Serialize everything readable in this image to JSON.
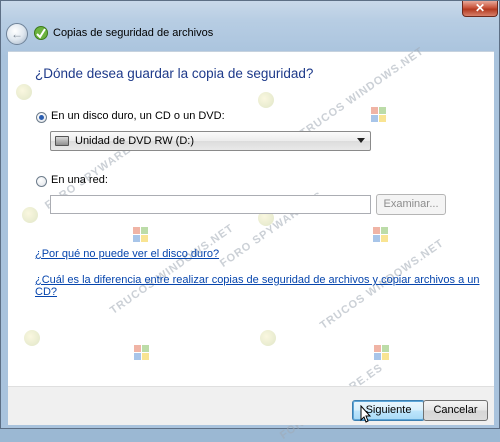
{
  "window": {
    "title": "Copias de seguridad de archivos",
    "close_glyph": "✕",
    "back_glyph": "←",
    "icons": [
      "back-arrow-icon",
      "backup-app-icon",
      "close-icon"
    ]
  },
  "heading": "¿Dónde desea guardar la copia de seguridad?",
  "option_disk": {
    "label": "En un disco duro, un CD o un DVD:",
    "selected": true,
    "drive_value": "Unidad de DVD RW (D:)"
  },
  "option_network": {
    "label": "En una red:",
    "selected": false,
    "path_value": "",
    "browse_label": "Examinar..."
  },
  "links": {
    "why_no_disk": "¿Por qué no puede ver el disco duro?",
    "difference": "¿Cuál es la diferencia entre realizar copias de seguridad de archivos y copiar archivos a un CD?"
  },
  "buttons": {
    "next": "Siguiente",
    "cancel": "Cancelar"
  },
  "watermarks": {
    "trucos": "TRUCOS WINDOWS.NET",
    "foro": "FORO SPYWARE.ES"
  },
  "colors": {
    "heading": "#1e3a8a",
    "link": "#0645ad",
    "titlebar": "#b7cde3",
    "close": "#c8533a"
  }
}
